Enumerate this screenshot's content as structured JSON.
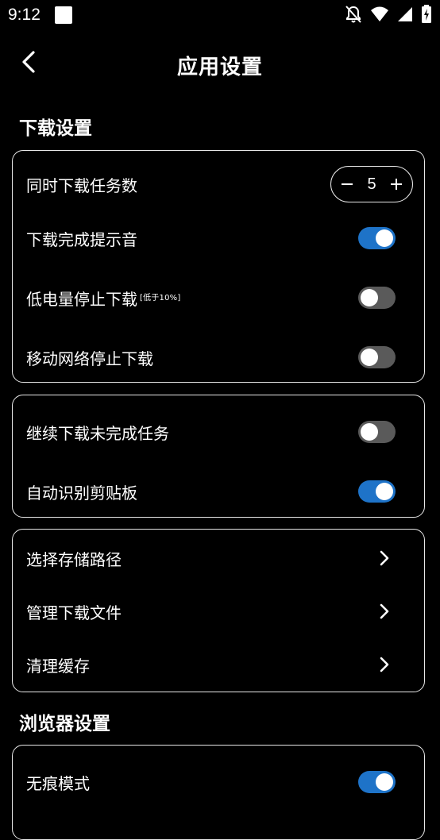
{
  "status_bar": {
    "time": "9:12",
    "icons": [
      "notifications-off-icon",
      "wifi-icon",
      "cellular-signal-icon",
      "battery-charging-icon"
    ]
  },
  "header": {
    "title": "应用设置",
    "back_icon": "back-arrow-icon"
  },
  "sections": {
    "download": {
      "title": "下载设置"
    },
    "browser": {
      "title": "浏览器设置"
    }
  },
  "card1": {
    "concurrent_tasks": {
      "label": "同时下载任务数",
      "value": "5",
      "minus": "−",
      "plus": "+"
    },
    "complete_sound": {
      "label": "下载完成提示音",
      "enabled": true
    },
    "low_battery_stop": {
      "label": "低电量停止下载",
      "sub": "[低于10%]",
      "enabled": false
    },
    "mobile_network_stop": {
      "label": "移动网络停止下载",
      "enabled": false
    }
  },
  "card2": {
    "resume_unfinished": {
      "label": "继续下载未完成任务",
      "enabled": false
    },
    "auto_clipboard": {
      "label": "自动识别剪贴板",
      "enabled": true
    }
  },
  "card3": {
    "storage_path": {
      "label": "选择存储路径"
    },
    "manage_files": {
      "label": "管理下载文件"
    },
    "clear_cache": {
      "label": "清理缓存"
    }
  },
  "card4": {
    "incognito": {
      "label": "无痕模式",
      "enabled": true
    }
  },
  "colors": {
    "background": "#000000",
    "toggle_on": "#1e73c8",
    "toggle_off": "#5a5a5a",
    "border": "#e8e8e8"
  }
}
